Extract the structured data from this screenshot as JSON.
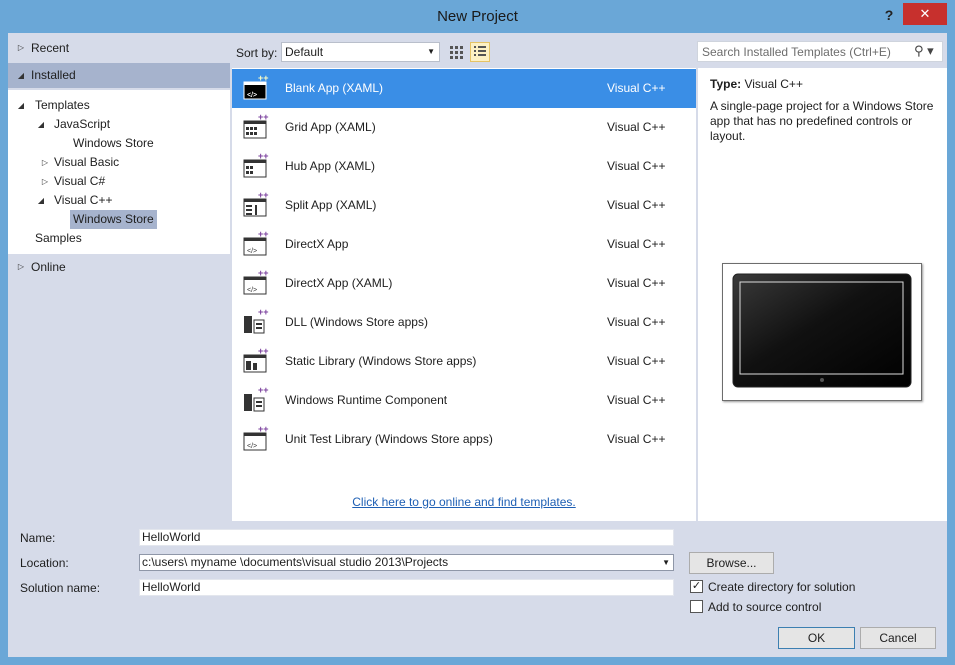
{
  "window": {
    "title": "New Project",
    "help_label": "?",
    "close_label": "✕"
  },
  "left_tree": {
    "recent": "Recent",
    "installed": "Installed",
    "templates": "Templates",
    "javascript": "JavaScript",
    "js_windows_store": "Windows Store",
    "visual_basic": "Visual Basic",
    "visual_csharp": "Visual C#",
    "visual_cpp": "Visual C++",
    "cpp_windows_store": "Windows Store",
    "samples": "Samples",
    "online": "Online"
  },
  "toolbar": {
    "sort_label": "Sort by:",
    "sort_value": "Default",
    "search_placeholder": "Search Installed Templates (Ctrl+E)"
  },
  "templates": [
    {
      "name": "Blank App (XAML)",
      "language": "Visual C++",
      "icon": "blank-app-icon"
    },
    {
      "name": "Grid App (XAML)",
      "language": "Visual C++",
      "icon": "grid-app-icon"
    },
    {
      "name": "Hub App (XAML)",
      "language": "Visual C++",
      "icon": "hub-app-icon"
    },
    {
      "name": "Split App (XAML)",
      "language": "Visual C++",
      "icon": "split-app-icon"
    },
    {
      "name": "DirectX App",
      "language": "Visual C++",
      "icon": "directx-app-icon"
    },
    {
      "name": "DirectX App (XAML)",
      "language": "Visual C++",
      "icon": "directx-xaml-app-icon"
    },
    {
      "name": "DLL (Windows Store apps)",
      "language": "Visual C++",
      "icon": "dll-icon"
    },
    {
      "name": "Static Library (Windows Store apps)",
      "language": "Visual C++",
      "icon": "static-library-icon"
    },
    {
      "name": "Windows Runtime Component",
      "language": "Visual C++",
      "icon": "runtime-component-icon"
    },
    {
      "name": "Unit Test Library (Windows Store apps)",
      "language": "Visual C++",
      "icon": "unit-test-icon"
    }
  ],
  "online_link": "Click here to go online and find templates.",
  "info": {
    "type_label": "Type:",
    "type_value": "Visual C++",
    "description": "A single-page project for a Windows Store app that has no predefined controls or layout."
  },
  "form": {
    "name_label": "Name:",
    "name_value": "HelloWorld",
    "location_label": "Location:",
    "location_value": "c:\\users\\ myname \\documents\\visual studio 2013\\Projects",
    "solution_label": "Solution name:",
    "solution_value": "HelloWorld",
    "browse_label": "Browse...",
    "create_dir_label": "Create directory for solution",
    "create_dir_checked": true,
    "source_control_label": "Add to source control",
    "source_control_checked": false,
    "ok_label": "OK",
    "cancel_label": "Cancel"
  },
  "colors": {
    "selection": "#3a8ee6",
    "frame": "#6aa7d7",
    "close": "#c7302d",
    "link": "#1e5fb4"
  }
}
